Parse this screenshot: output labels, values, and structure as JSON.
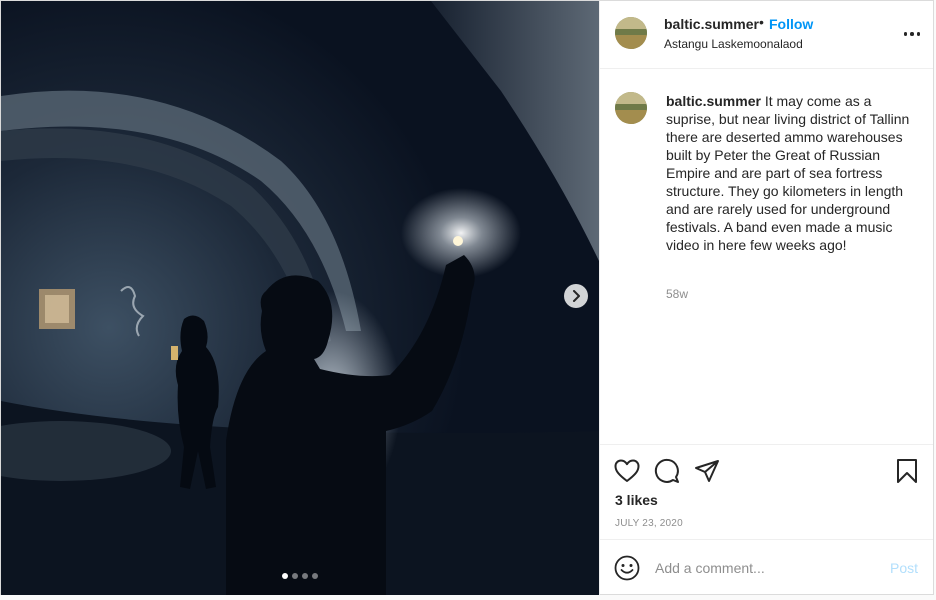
{
  "post": {
    "media": {
      "slide_count": 4,
      "active_slide": 1,
      "next_icon": "chevron-right-icon"
    },
    "header": {
      "username": "baltic.summer",
      "separator": "•",
      "follow_label": "Follow",
      "location": "Astangu Laskemoonalaod",
      "more_icon": "more-horizontal-icon"
    },
    "caption": {
      "username": "baltic.summer",
      "text": "It may come as a suprise, but near living district of Tallinn there are deserted ammo warehouses built by Peter the Great of Russian Empire and are part of sea fortress structure. They go kilometers in length and are rarely used for underground festivals. A band even made a music video in here few weeks ago!",
      "time_ago": "58w"
    },
    "actions": {
      "icons": [
        "heart-icon",
        "comment-icon",
        "share-icon",
        "bookmark-icon"
      ],
      "likes": "3 likes",
      "date": "JULY 23, 2020"
    },
    "comment": {
      "placeholder": "Add a comment...",
      "post_label": "Post",
      "emoji_icon": "emoji-icon"
    },
    "colors": {
      "accent": "#0095f6",
      "post_disabled": "#b2dffc",
      "muted_text": "#8e8e8e",
      "border": "#dbdbdb"
    }
  }
}
